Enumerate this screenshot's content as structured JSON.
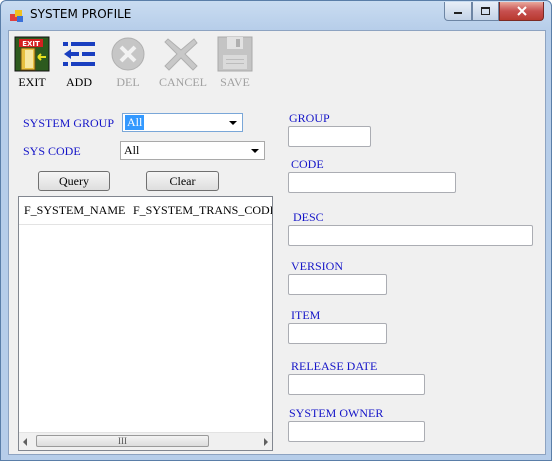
{
  "window": {
    "title": "SYSTEM PROFILE"
  },
  "toolbar": [
    {
      "id": "exit",
      "label": "EXIT",
      "icon": "exit-door-icon",
      "enabled": true
    },
    {
      "id": "add",
      "label": "ADD",
      "icon": "add-arrow-icon",
      "enabled": true
    },
    {
      "id": "del",
      "label": "DEL",
      "icon": "delete-x-circle-icon",
      "enabled": false
    },
    {
      "id": "cancel",
      "label": "CANCEL",
      "icon": "cancel-x-icon",
      "enabled": false
    },
    {
      "id": "save",
      "label": "SAVE",
      "icon": "save-disk-icon",
      "enabled": false
    }
  ],
  "filters": {
    "system_group_label": "SYSTEM GROUP",
    "system_group_value": "All",
    "sys_code_label": "SYS CODE",
    "sys_code_value": "All",
    "query_label": "Query",
    "clear_label": "Clear"
  },
  "grid": {
    "columns": [
      "F_SYSTEM_NAME",
      "F_SYSTEM_TRANS_CODE"
    ],
    "rows": [],
    "scroll_grip": "III"
  },
  "form": {
    "group_label": "GROUP",
    "code_label": "CODE",
    "desc_label": "DESC",
    "version_label": "VERSION",
    "item_label": "ITEM",
    "release_date_label": "RELEASE DATE",
    "system_owner_label": "SYSTEM OWNER"
  },
  "colors": {
    "label_blue": "#1515c8",
    "selection": "#3399ff"
  }
}
